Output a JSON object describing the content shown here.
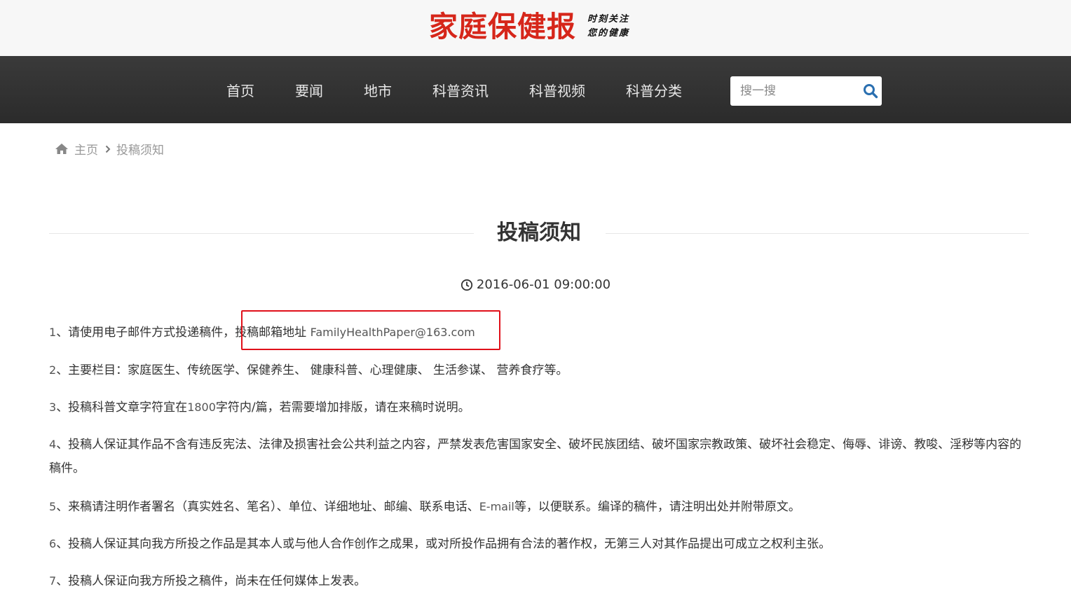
{
  "header": {
    "logo_text": "家庭保健报",
    "slogan_line1": "时刻关注",
    "slogan_line2": "您的健康",
    "brand_color": "#d6261a"
  },
  "nav": {
    "items": [
      {
        "label": "首页"
      },
      {
        "label": "要闻"
      },
      {
        "label": "地市"
      },
      {
        "label": "科普资讯"
      },
      {
        "label": "科普视频"
      },
      {
        "label": "科普分类"
      }
    ],
    "search": {
      "placeholder": "搜一搜",
      "icon": "search-icon"
    }
  },
  "breadcrumb": {
    "home_icon": "home-icon",
    "home_label": "主页",
    "current": "投稿须知"
  },
  "article": {
    "title": "投稿须知",
    "date": "2016-06-01 09:00:00",
    "date_icon": "clock-icon",
    "paragraphs": [
      {
        "num": "1",
        "text": "、请使用电子邮件方式投递稿件，",
        "email_label": "投稿邮箱地址",
        "email": "FamilyHealthPaper@163.com"
      },
      {
        "num": "2",
        "text": "、主要栏目：家庭医生、传统医学、保健养生、 健康科普、心理健康、 生活参谋、 营养食疗等。"
      },
      {
        "num": "3",
        "text_a": "、投稿科普文章字符宜在",
        "num_inline": "1800",
        "text_b": "字符内/篇，若需要增加排版，请在来稿时说明。"
      },
      {
        "num": "4",
        "text": "、投稿人保证其作品不含有违反宪法、法律及损害社会公共利益之内容，严禁发表危害国家安全、破坏民族团结、破坏国家宗教政策、破坏社会稳定、侮辱、诽谤、教唆、淫秽等内容的稿件。"
      },
      {
        "num": "5",
        "text_a": "、来稿请注明作者署名（真实姓名、笔名）、单位、详细地址、邮编、联系电话、",
        "email_word": "E-mail",
        "text_b": "等，以便联系。编译的稿件，请注明出处并附带原文。"
      },
      {
        "num": "6",
        "text": "、投稿人保证其向我方所投之作品是其本人或与他人合作创作之成果，或对所投作品拥有合法的著作权，无第三人对其作品提出可成立之权利主张。"
      },
      {
        "num": "7",
        "text": "、投稿人保证向我方所投之稿件，尚未在任何媒体上发表。"
      }
    ]
  },
  "colors": {
    "nav_bg": "#2f2f2f",
    "highlight_border": "#e0101a"
  }
}
